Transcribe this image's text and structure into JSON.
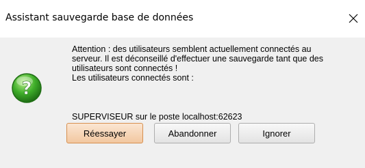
{
  "window": {
    "title": "Assistant sauvegarde base de données",
    "close_icon": "close-icon"
  },
  "dialog": {
    "icon": "question-icon",
    "message_lines": [
      "Attention : des utilisateurs semblent actuellement connectés au",
      "serveur. Il est déconseillé d'effectuer une sauvegarde tant que des",
      "utilisateurs sont connectés !",
      "Les utilisateurs connectés sont :"
    ],
    "user_line": "SUPERVISEUR sur le poste localhost:62623"
  },
  "buttons": {
    "retry": "Réessayer",
    "abort": "Abandonner",
    "ignore": "Ignorer"
  },
  "colors": {
    "primary_button": "#f2c7a0",
    "content_bg": "#f0f0f0",
    "icon_green": "#3fae2a"
  }
}
